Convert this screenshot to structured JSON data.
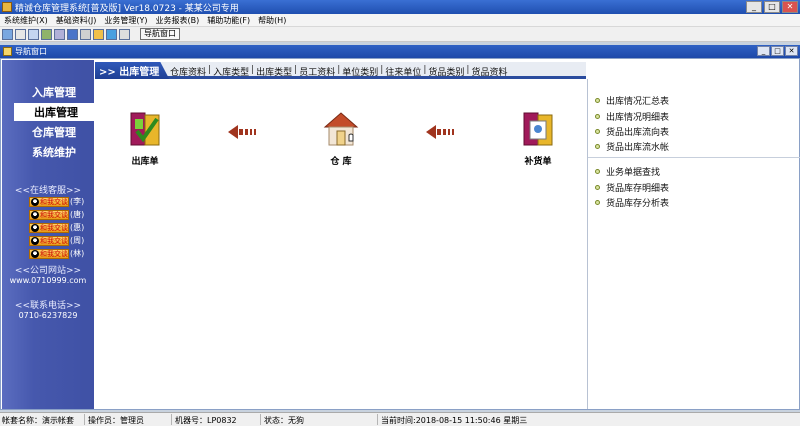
{
  "window": {
    "title": "精诚仓库管理系统[普及版] Ver18.0723 - 某某公司专用"
  },
  "menu": [
    {
      "label": "系统维护",
      "key": "(X)"
    },
    {
      "label": "基础资料",
      "key": "(J)"
    },
    {
      "label": "业务管理",
      "key": "(Y)"
    },
    {
      "label": "业务报表",
      "key": "(B)"
    },
    {
      "label": "辅助功能",
      "key": "(F)"
    },
    {
      "label": "帮助",
      "key": "(H)"
    }
  ],
  "toolbar": {
    "nav_window_label": "导航窗口"
  },
  "child_window": {
    "title": "导航窗口"
  },
  "sidebar": {
    "items": [
      {
        "label": "入库管理"
      },
      {
        "label": "出库管理"
      },
      {
        "label": "仓库管理"
      },
      {
        "label": "系统维护"
      }
    ],
    "active_index": 1,
    "kefu_title": "<<在线客服>>",
    "qq_button_text": "和我交谈",
    "kefu": [
      {
        "name": "(李)"
      },
      {
        "name": "(唐)"
      },
      {
        "name": "(惠)"
      },
      {
        "name": "(周)"
      },
      {
        "name": "(林)"
      }
    ],
    "site_title": "<<公司网站>>",
    "site_url": "www.0710999.com",
    "tel_title": "<<联系电话>>",
    "tel_number": "0710-6237829"
  },
  "tabs": {
    "active": ">> 出库管理",
    "items": [
      "仓库资料",
      "入库类型",
      "出库类型",
      "员工资料",
      "单位类别",
      "往来单位",
      "货品类别",
      "货品资料"
    ],
    "separator": "|"
  },
  "flow": {
    "items": [
      {
        "label": "出库单",
        "icon": "outbound-slip-icon"
      },
      {
        "label": "仓 库",
        "icon": "warehouse-icon"
      },
      {
        "label": "补货单",
        "icon": "restock-slip-icon"
      }
    ],
    "arrow_color": "#a0341e"
  },
  "right_panel": {
    "group1": [
      "出库情况汇总表",
      "出库情况明细表",
      "货品出库流向表",
      "货品出库流水帐"
    ],
    "group2": [
      "业务单据查找",
      "货品库存明细表",
      "货品库存分析表"
    ]
  },
  "status": {
    "account": "帐套名称：演示帐套",
    "operator": "操作员：管理员",
    "machine": "机器号：LP0832",
    "state": "状态：无狗",
    "time": "当前时间:2018-08-15 11:50:46 星期三"
  },
  "colors": {
    "title_bar": "#2f61c4",
    "sidebar": "#4658ad",
    "tab_underline": "#2b4c9e"
  }
}
